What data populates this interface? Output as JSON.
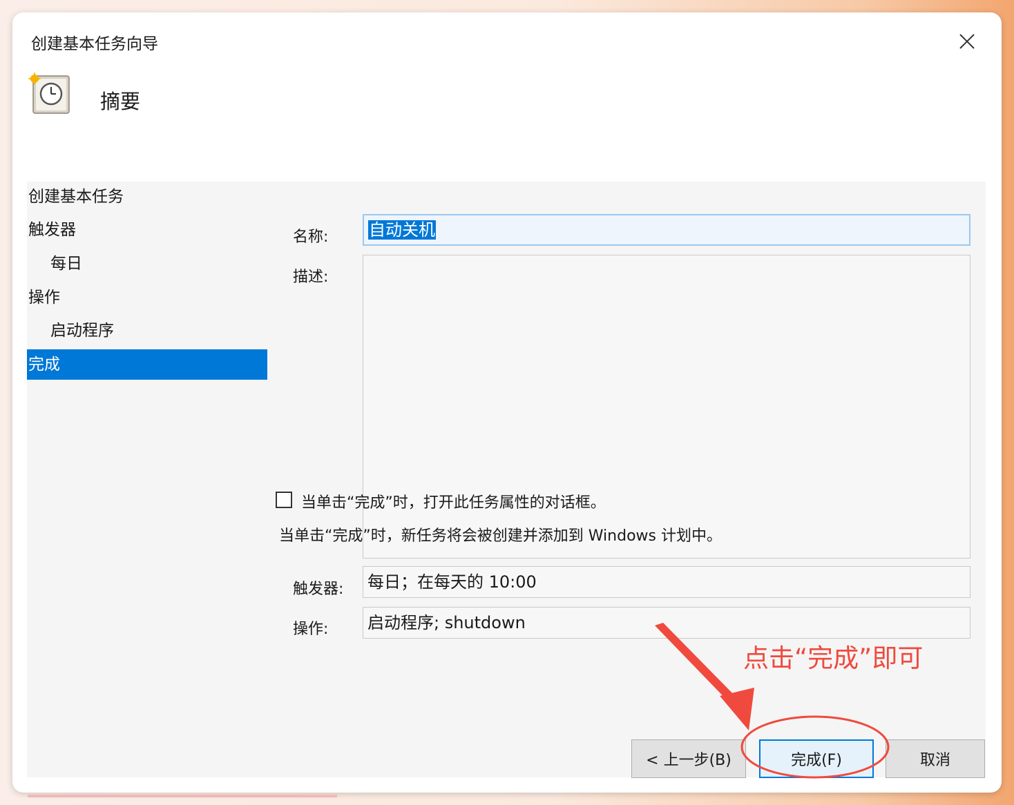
{
  "window": {
    "title": "创建基本任务向导"
  },
  "header": {
    "title": "摘要"
  },
  "nav": {
    "items": [
      {
        "label": "创建基本任务"
      },
      {
        "label": "触发器"
      },
      {
        "label": "每日"
      },
      {
        "label": "操作"
      },
      {
        "label": "启动程序"
      },
      {
        "label": "完成"
      }
    ]
  },
  "form": {
    "name_label": "名称:",
    "name_value": "自动关机",
    "description_label": "描述:",
    "description_value": "",
    "trigger_label": "触发器:",
    "trigger_value": "每日；在每天的 10:00",
    "action_label": "操作:",
    "action_value": "启动程序; shutdown",
    "open_properties_label": "当单击“完成”时，打开此任务属性的对话框。",
    "open_properties_checked": false,
    "info_text": "当单击“完成”时，新任务将会被创建并添加到 Windows 计划中。"
  },
  "buttons": {
    "back": "< 上一步(B)",
    "finish": "完成(F)",
    "cancel": "取消"
  },
  "annotation": {
    "text": "点击“完成”即可",
    "color": "#f04a3e"
  },
  "colors": {
    "accent": "#0078d7",
    "annotation": "#f04a3e"
  },
  "icons": {
    "close": "close-icon",
    "task": "task-scheduler-clock-icon"
  }
}
